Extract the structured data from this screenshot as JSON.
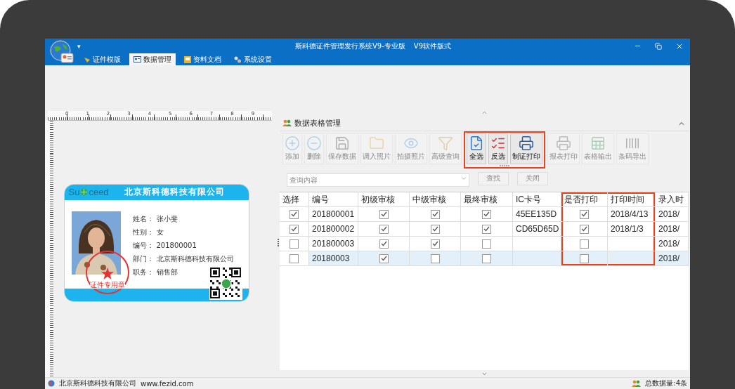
{
  "window": {
    "title": "斯科德证件管理发行系统V9-专业版",
    "subtitle": "V9软件版式",
    "quick_access": "▾"
  },
  "ribbon_tabs": [
    {
      "label": "证件模版",
      "selected": false
    },
    {
      "label": "数据管理",
      "selected": true
    },
    {
      "label": "资料文档",
      "selected": false
    },
    {
      "label": "系统设置",
      "selected": false
    }
  ],
  "designer": {
    "ruler_labels": [
      "0",
      "1",
      "2",
      "3",
      "4",
      "5",
      "6",
      "7",
      "8",
      "9"
    ],
    "card": {
      "logo_left": "Su",
      "logo_right": "ceed",
      "company": "北京斯科德科技有限公司",
      "fields": [
        {
          "label": "姓名：",
          "value": "张小斐"
        },
        {
          "label": "性别：",
          "value": "女"
        },
        {
          "label": "编号：",
          "value": "201800001"
        },
        {
          "label": "部门：",
          "value": "北京斯科德科技有限公司"
        },
        {
          "label": "职务：",
          "value": "销售部"
        }
      ],
      "stamp": "证件专用章"
    }
  },
  "data_panel": {
    "title": "数据表格管理",
    "toolbar": [
      {
        "label": "添加",
        "disabled": true,
        "highlighted": false
      },
      {
        "label": "删除",
        "disabled": true,
        "highlighted": false
      },
      {
        "label": "保存数据",
        "disabled": true,
        "highlighted": false
      },
      {
        "label": "调入照片",
        "disabled": true,
        "highlighted": false
      },
      {
        "label": "拍摄照片",
        "disabled": true,
        "highlighted": false
      },
      {
        "label": "高级查询",
        "disabled": true,
        "highlighted": false
      },
      {
        "label": "全选",
        "disabled": false,
        "highlighted": true
      },
      {
        "label": "反选",
        "disabled": false,
        "highlighted": true
      },
      {
        "label": "制证打印",
        "disabled": false,
        "highlighted": true
      },
      {
        "label": "报表打印",
        "disabled": true,
        "highlighted": false
      },
      {
        "label": "表格输出",
        "disabled": true,
        "highlighted": false
      },
      {
        "label": "条码导出",
        "disabled": true,
        "highlighted": false
      }
    ],
    "search": {
      "placeholder": "查询内容",
      "disabled": true,
      "buttons": [
        {
          "label": "查找",
          "disabled": true
        },
        {
          "label": "关闭",
          "disabled": true
        }
      ]
    },
    "table": {
      "columns": [
        {
          "label": "选择",
          "kind": "check",
          "highlighted": false
        },
        {
          "label": "编号",
          "kind": "text",
          "highlighted": false
        },
        {
          "label": "初级审核",
          "kind": "check",
          "highlighted": false
        },
        {
          "label": "中级审核",
          "kind": "check",
          "highlighted": false
        },
        {
          "label": "最终审核",
          "kind": "check",
          "highlighted": false
        },
        {
          "label": "IC卡号",
          "kind": "text",
          "highlighted": false
        },
        {
          "label": "是否打印",
          "kind": "check",
          "highlighted": true
        },
        {
          "label": "打印时间",
          "kind": "text",
          "highlighted": true
        },
        {
          "label": "录入时",
          "kind": "text",
          "highlighted": false
        }
      ],
      "rows": [
        {
          "selected": false,
          "cells": [
            {
              "checked": true
            },
            {
              "text": "201800001"
            },
            {
              "checked": true
            },
            {
              "checked": true
            },
            {
              "checked": true
            },
            {
              "text": "45EE135D"
            },
            {
              "checked": true
            },
            {
              "text": "2018/4/13"
            },
            {
              "text": "2018/"
            }
          ]
        },
        {
          "selected": false,
          "cells": [
            {
              "checked": true
            },
            {
              "text": "201800002"
            },
            {
              "checked": true
            },
            {
              "checked": true
            },
            {
              "checked": true
            },
            {
              "text": "CD65D65D"
            },
            {
              "checked": true
            },
            {
              "text": "2018/1/3"
            },
            {
              "text": "2018/"
            }
          ]
        },
        {
          "selected": false,
          "cells": [
            {
              "checked": false
            },
            {
              "text": "201800003"
            },
            {
              "checked": true
            },
            {
              "checked": true
            },
            {
              "checked": false
            },
            {},
            {
              "checked": false
            },
            {},
            {
              "text": "2018/"
            }
          ]
        },
        {
          "selected": true,
          "cells": [
            {
              "checked": false
            },
            {
              "text": "20180003"
            },
            {
              "checked": true
            },
            {
              "checked": false
            },
            {
              "checked": false
            },
            {},
            {
              "checked": false
            },
            {},
            {
              "text": "2018/"
            }
          ]
        }
      ]
    }
  },
  "status_bar": {
    "company": "北京斯科德科技有限公司",
    "website": "www.fezid.com",
    "count": "总数据量:4条"
  }
}
